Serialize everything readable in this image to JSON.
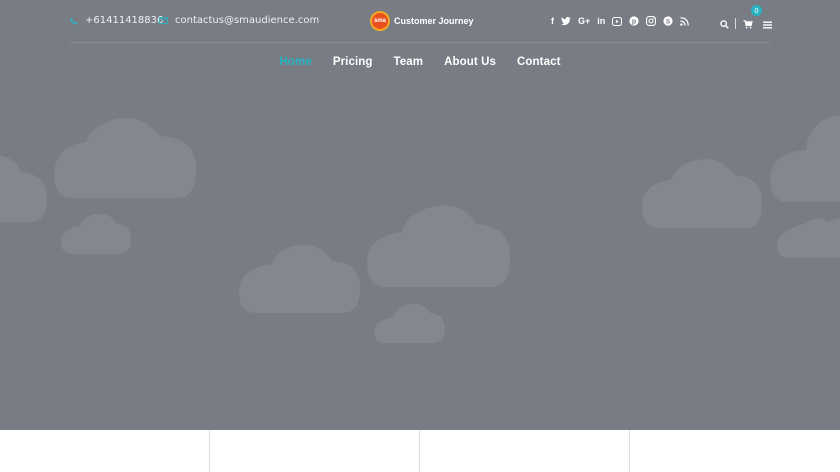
{
  "topbar": {
    "phone": "+61411418836",
    "email": "contactus@smaudience.com"
  },
  "logo": {
    "mark": "sma",
    "text": "Customer Journey"
  },
  "social_icons": [
    "facebook-icon",
    "twitter-icon",
    "google-plus-icon",
    "linkedin-icon",
    "youtube-icon",
    "pinterest-icon",
    "instagram-icon",
    "skype-icon",
    "rss-icon"
  ],
  "tools": {
    "cart_count": "0"
  },
  "nav": {
    "items": [
      {
        "label": "Home"
      },
      {
        "label": "Pricing"
      },
      {
        "label": "Team"
      },
      {
        "label": "About Us"
      },
      {
        "label": "Contact"
      }
    ]
  },
  "colors": {
    "hero_bg": "#787c85",
    "accent": "#27b3c4",
    "cloud": "#83878f"
  }
}
